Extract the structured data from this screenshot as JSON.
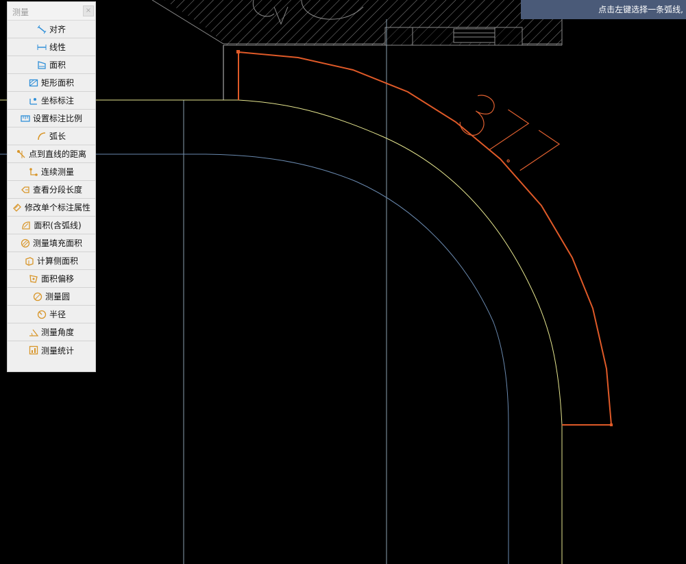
{
  "hint_bar": {
    "text": "点击左键选择一条弧线,"
  },
  "panel": {
    "title": "测量",
    "close_label": "×",
    "items": [
      {
        "label": "对齐",
        "icon": "align-measure-icon",
        "color": "#2f8fd8"
      },
      {
        "label": "线性",
        "icon": "linear-measure-icon",
        "color": "#2f8fd8"
      },
      {
        "label": "面积",
        "icon": "area-icon",
        "color": "#2f8fd8"
      },
      {
        "label": "矩形面积",
        "icon": "rect-area-icon",
        "color": "#2f8fd8"
      },
      {
        "label": "坐标标注",
        "icon": "coordinate-annotation-icon",
        "color": "#2f8fd8"
      },
      {
        "label": "设置标注比例",
        "icon": "annotation-scale-icon",
        "color": "#2f8fd8"
      },
      {
        "label": "弧长",
        "icon": "arc-length-icon",
        "color": "#d8962a"
      },
      {
        "label": "点到直线的距离",
        "icon": "point-line-distance-icon",
        "color": "#d8962a"
      },
      {
        "label": "连续测量",
        "icon": "continuous-measure-icon",
        "color": "#d8962a"
      },
      {
        "label": "查看分段长度",
        "icon": "segment-length-icon",
        "color": "#d8962a"
      },
      {
        "label": "修改单个标注属性",
        "icon": "edit-annotation-icon",
        "color": "#d8962a"
      },
      {
        "label": "面积(含弧线)",
        "icon": "arc-area-icon",
        "color": "#d8962a"
      },
      {
        "label": "测量填充面积",
        "icon": "fill-area-icon",
        "color": "#d8962a"
      },
      {
        "label": "计算侧面积",
        "icon": "side-area-icon",
        "color": "#d8962a"
      },
      {
        "label": "面积偏移",
        "icon": "area-offset-icon",
        "color": "#d8962a"
      },
      {
        "label": "测量圆",
        "icon": "measure-circle-icon",
        "color": "#d8962a"
      },
      {
        "label": "半径",
        "icon": "radius-icon",
        "color": "#d8962a"
      },
      {
        "label": "测量角度",
        "icon": "angle-icon",
        "color": "#d8962a"
      },
      {
        "label": "测量统计",
        "icon": "measure-stats-icon",
        "color": "#d8962a"
      }
    ]
  },
  "drawing": {
    "dimension_value": "37.7",
    "colors": {
      "measured_arc": "#e05a28",
      "inner_arc": "#e8e890",
      "blue_arc": "#6a8ab0",
      "gridline": "#8aa0b0",
      "hatch": "#9a9a9a"
    }
  }
}
